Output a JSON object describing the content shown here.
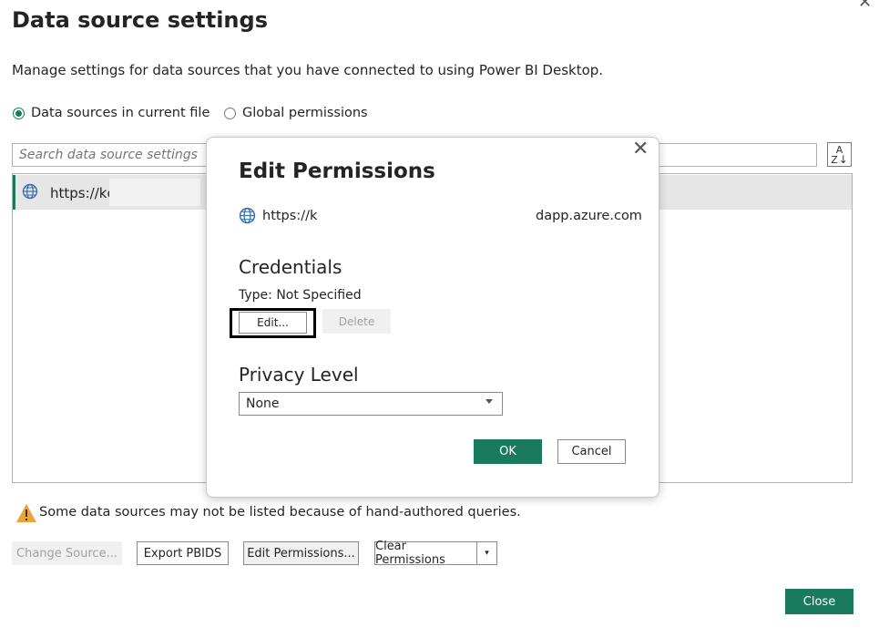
{
  "window": {
    "title": "Data source settings",
    "close_glyph": "✕",
    "description": "Manage settings for data sources that you have connected to using Power BI Desktop."
  },
  "scope": {
    "options": [
      {
        "label": "Data sources in current file",
        "selected": true
      },
      {
        "label": "Global permissions",
        "selected": false
      }
    ]
  },
  "search": {
    "placeholder": "Search data source settings",
    "sort_icon": "sort-az-icon",
    "sort_top": "A",
    "sort_bottom": "Z"
  },
  "list": {
    "items": [
      {
        "icon": "globe-icon",
        "url": "https://kc",
        "selected": true
      }
    ]
  },
  "warning": {
    "icon": "warning-icon",
    "text": "Some data sources may not be listed because of hand-authored queries."
  },
  "actions": {
    "change_source": "Change Source...",
    "export": "Export PBIDS",
    "edit_permissions": "Edit Permissions...",
    "clear_permissions": "Clear Permissions",
    "clear_arrow": "▾",
    "close": "Close"
  },
  "modal": {
    "title": "Edit Permissions",
    "close_glyph": "✕",
    "url_start": "https://k",
    "url_end": "dapp.azure.com",
    "credentials_heading": "Credentials",
    "credentials_type": "Type: Not Specified",
    "edit_label": "Edit...",
    "delete_label": "Delete",
    "privacy_heading": "Privacy Level",
    "privacy_value": "None",
    "ok_label": "OK",
    "cancel_label": "Cancel"
  },
  "colors": {
    "accent": "#1a7a5e",
    "selection": "#e6e6e6",
    "warning": "#e8a53a"
  }
}
